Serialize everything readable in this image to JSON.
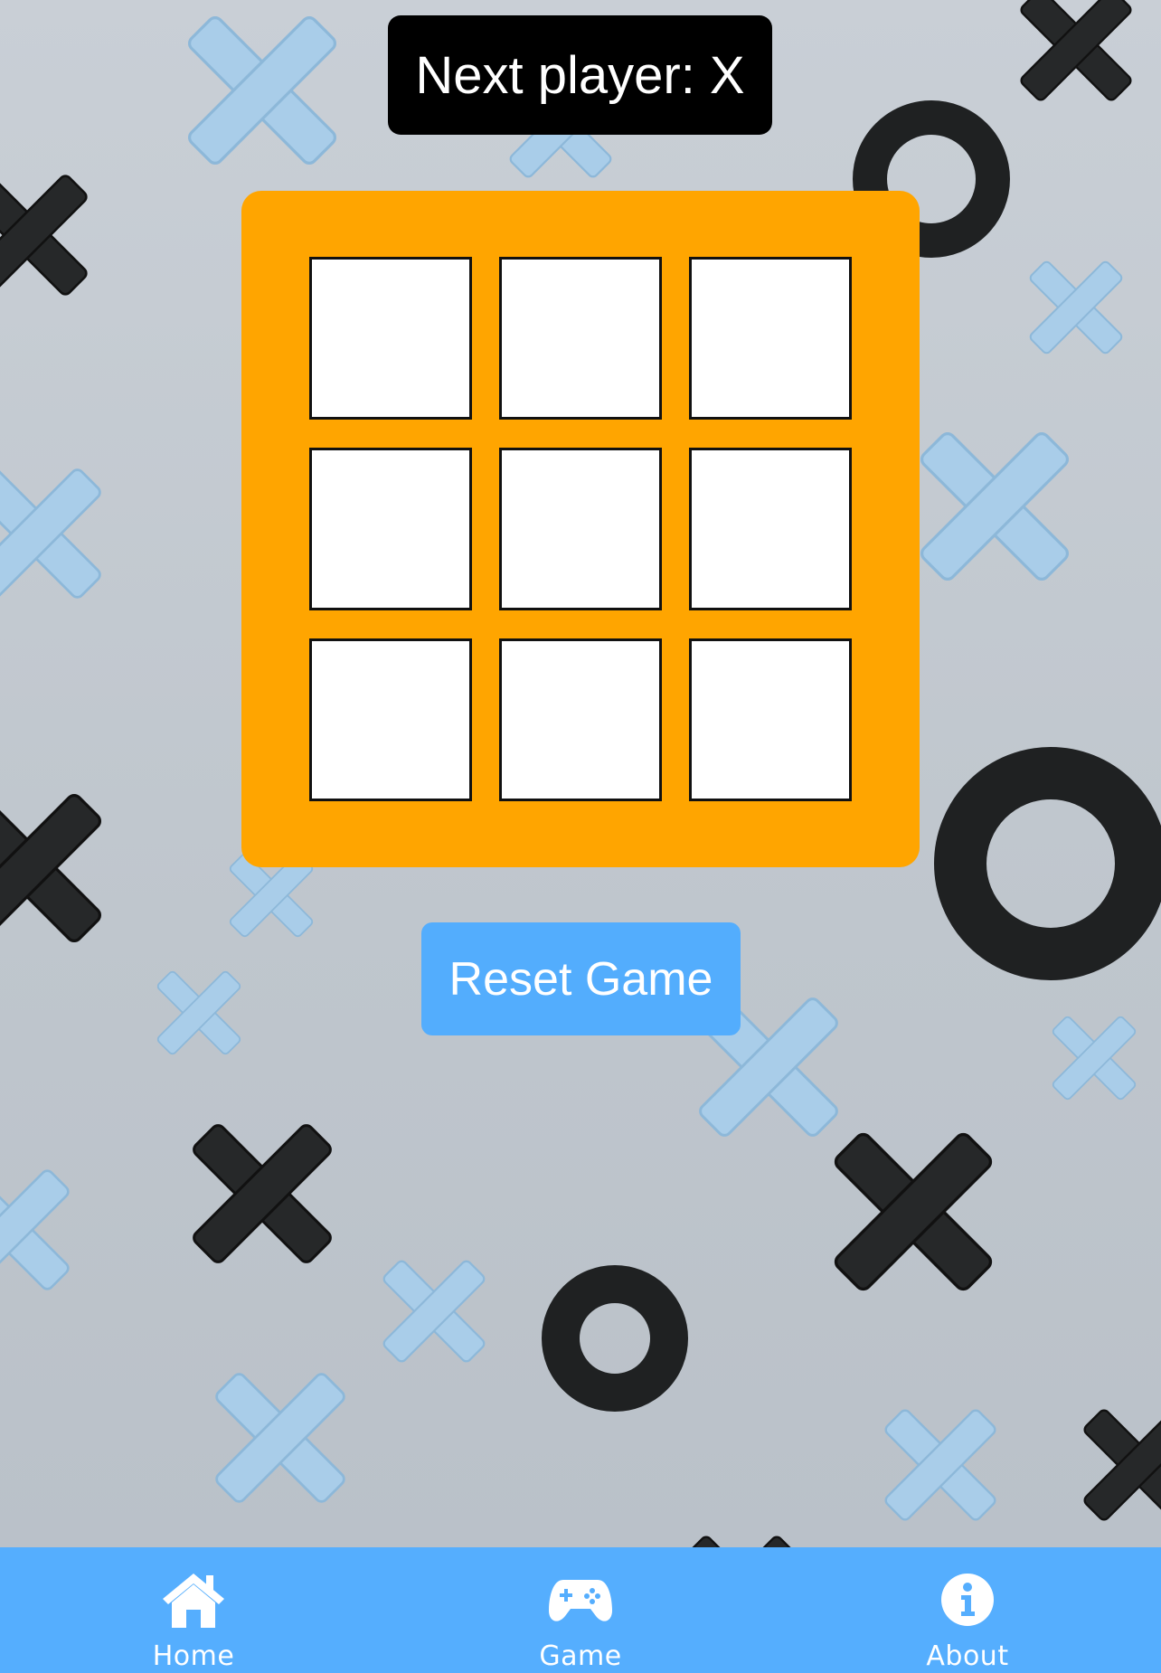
{
  "status": {
    "text": "Next player: X"
  },
  "board": {
    "cells": [
      "",
      "",
      "",
      "",
      "",
      "",
      "",
      "",
      ""
    ]
  },
  "reset_button": {
    "label": "Reset Game"
  },
  "bottom_nav": {
    "items": [
      {
        "label": "Home",
        "icon": "home-icon"
      },
      {
        "label": "Game",
        "icon": "gamepad-icon"
      },
      {
        "label": "About",
        "icon": "info-icon"
      }
    ]
  },
  "colors": {
    "board": "#ffa500",
    "button": "#53adfd",
    "nav": "#55aefe",
    "status_bg": "#000000"
  }
}
